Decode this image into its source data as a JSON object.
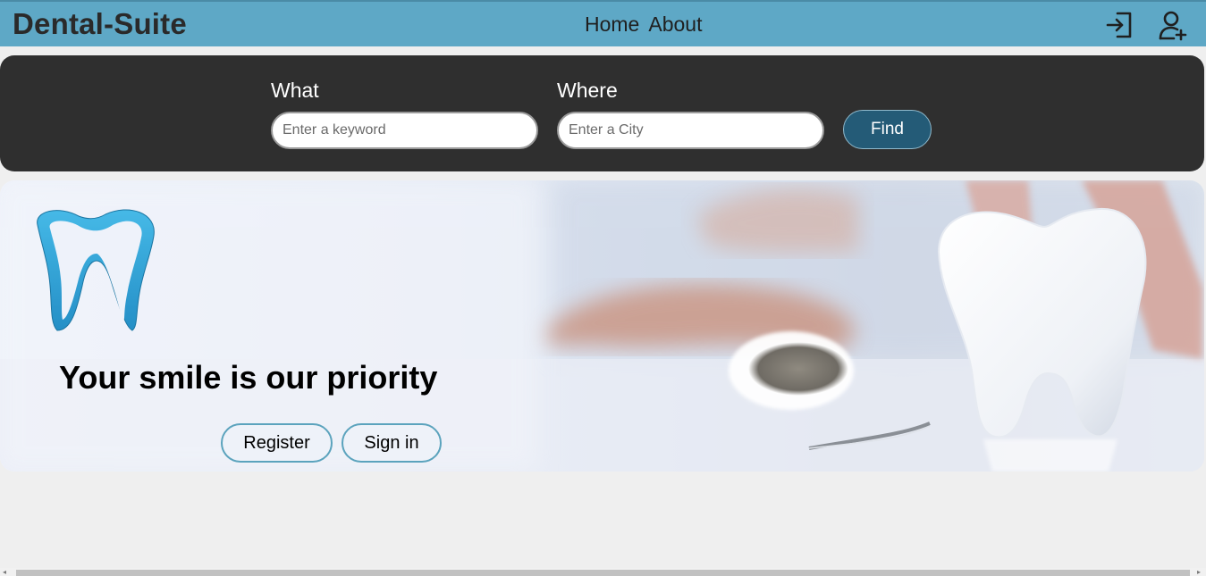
{
  "header": {
    "brand": "Dental-Suite",
    "nav": [
      {
        "label": "Home"
      },
      {
        "label": "About"
      }
    ],
    "icons": [
      "sign-in-icon",
      "add-user-icon"
    ],
    "bar_color": "#5ea8c6"
  },
  "search": {
    "what_label": "What",
    "what_placeholder": "Enter a keyword",
    "where_label": "Where",
    "where_placeholder": "Enter a City",
    "find_label": "Find",
    "button_color": "#245b77",
    "panel_color": "#2f2f2f"
  },
  "hero": {
    "title": "Your smile is our priority",
    "register_label": "Register",
    "signin_label": "Sign in",
    "logo_icon": "tooth-logo-icon"
  }
}
